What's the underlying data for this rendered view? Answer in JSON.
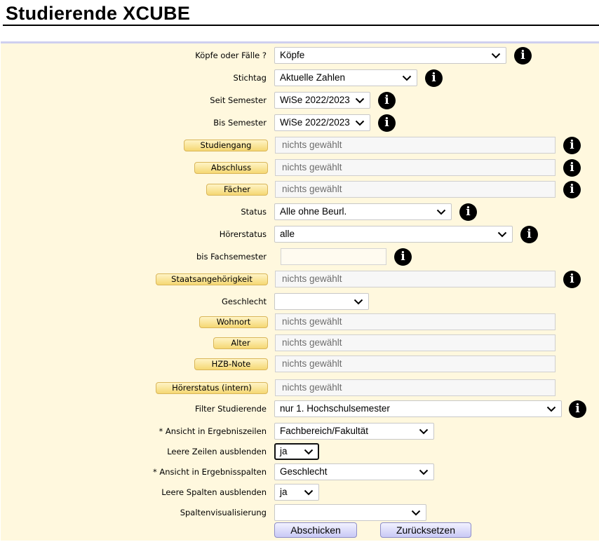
{
  "page": {
    "title": "Studierende XCUBE"
  },
  "info_icon": "info-circle-icon",
  "dropdown_icon": "chevron-down-icon",
  "form": {
    "koepfe": {
      "label": "Köpfe oder Fälle ?",
      "value": "Köpfe"
    },
    "stichtag": {
      "label": "Stichtag",
      "value": "Aktuelle Zahlen"
    },
    "seit_semester": {
      "label": "Seit Semester",
      "value": "WiSe 2022/2023"
    },
    "bis_semester": {
      "label": "Bis Semester",
      "value": "WiSe 2022/2023"
    },
    "studiengang": {
      "button": "Studiengang",
      "value": "nichts gewählt"
    },
    "abschluss": {
      "button": "Abschluss",
      "value": "nichts gewählt"
    },
    "faecher": {
      "button": "Fächer",
      "value": "nichts gewählt"
    },
    "status": {
      "label": "Status",
      "value": "Alle ohne Beurl."
    },
    "hoererstatus": {
      "label": "Hörerstatus",
      "value": "alle"
    },
    "bis_fachsemester": {
      "label": "bis Fachsemester",
      "value": ""
    },
    "staatsangehoerigkeit": {
      "button": "Staatsangehörigkeit",
      "value": "nichts gewählt"
    },
    "geschlecht": {
      "label": "Geschlecht",
      "value": ""
    },
    "wohnort": {
      "button": "Wohnort",
      "value": "nichts gewählt"
    },
    "alter": {
      "button": "Alter",
      "value": "nichts gewählt"
    },
    "hzb_note": {
      "button": "HZB-Note",
      "value": "nichts gewählt"
    },
    "hoererstatus_intern": {
      "button": "Hörerstatus (intern)",
      "value": "nichts gewählt"
    },
    "filter": {
      "label": "Filter Studierende",
      "value": "nur 1. Hochschulsemester"
    },
    "zeilen": {
      "label": "* Ansicht in Ergebniszeilen",
      "value": "Fachbereich/Fakultät"
    },
    "leere_zeilen": {
      "label": "Leere Zeilen ausblenden",
      "value": "ja"
    },
    "spalten": {
      "label": "* Ansicht in Ergebnisspalten",
      "value": "Geschlecht"
    },
    "leere_spalten": {
      "label": "Leere Spalten ausblenden",
      "value": "ja"
    },
    "spaltenvis": {
      "label": "Spaltenvisualisierung",
      "value": ""
    }
  },
  "buttons": {
    "submit": "Abschicken",
    "reset": "Zurücksetzen"
  },
  "colors": {
    "panel_bg": "#fff8de",
    "panel_border": "#cfcfef",
    "button_bg": "#c9c9f5",
    "pill_bg": "#f5d773"
  }
}
